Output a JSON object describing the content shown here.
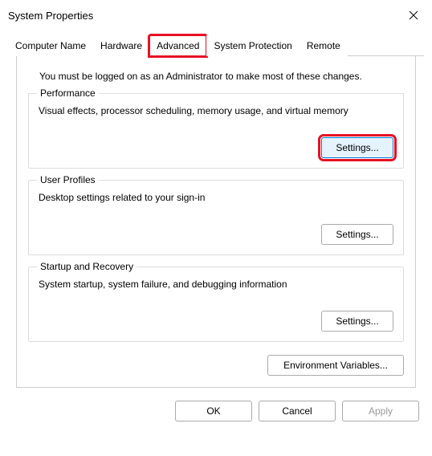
{
  "title": "System Properties",
  "tabs": {
    "computer_name": "Computer Name",
    "hardware": "Hardware",
    "advanced": "Advanced",
    "system_protection": "System Protection",
    "remote": "Remote"
  },
  "admin_note": "You must be logged on as an Administrator to make most of these changes.",
  "groups": {
    "performance": {
      "legend": "Performance",
      "desc": "Visual effects, processor scheduling, memory usage, and virtual memory",
      "button": "Settings..."
    },
    "user_profiles": {
      "legend": "User Profiles",
      "desc": "Desktop settings related to your sign-in",
      "button": "Settings..."
    },
    "startup": {
      "legend": "Startup and Recovery",
      "desc": "System startup, system failure, and debugging information",
      "button": "Settings..."
    }
  },
  "env_button": "Environment Variables...",
  "footer": {
    "ok": "OK",
    "cancel": "Cancel",
    "apply": "Apply"
  }
}
